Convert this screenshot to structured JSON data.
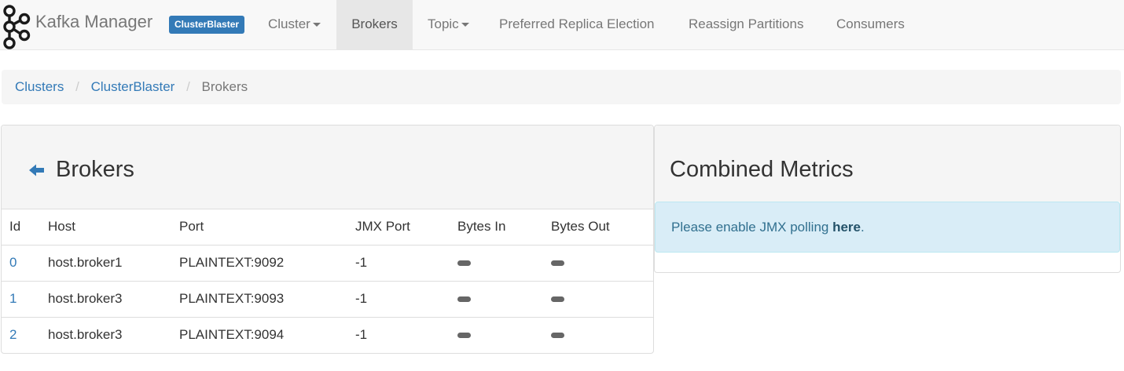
{
  "navbar": {
    "brand": "Kafka Manager",
    "cluster_badge": "ClusterBlaster",
    "items": [
      {
        "label": "Cluster"
      },
      {
        "label": "Brokers"
      },
      {
        "label": "Topic"
      },
      {
        "label": "Preferred Replica Election"
      },
      {
        "label": "Reassign Partitions"
      },
      {
        "label": "Consumers"
      }
    ],
    "active_item": "Brokers"
  },
  "breadcrumb": {
    "items": [
      "Clusters",
      "ClusterBlaster",
      "Brokers"
    ],
    "separator": "/"
  },
  "brokers_panel": {
    "title": "Brokers",
    "columns": [
      "Id",
      "Host",
      "Port",
      "JMX Port",
      "Bytes In",
      "Bytes Out"
    ],
    "rows": [
      {
        "id": "0",
        "host": "host.broker1",
        "port": "PLAINTEXT:9092",
        "jmx_port": "-1"
      },
      {
        "id": "1",
        "host": "host.broker3",
        "port": "PLAINTEXT:9093",
        "jmx_port": "-1"
      },
      {
        "id": "2",
        "host": "host.broker3",
        "port": "PLAINTEXT:9094",
        "jmx_port": "-1"
      }
    ]
  },
  "metrics_panel": {
    "title": "Combined Metrics",
    "alert_prefix": "Please enable JMX polling ",
    "alert_link": "here",
    "alert_suffix": "."
  },
  "colors": {
    "link": "#337ab7",
    "badge_bg": "#337ab7",
    "navbar_bg": "#f8f8f8",
    "active_nav_bg": "#e7e7e7",
    "alert_bg": "#d9edf7",
    "alert_text": "#31708f"
  },
  "icons": {
    "logo": "kafka-logo-icon",
    "back": "arrow-left-icon",
    "dropdown": "caret-down-icon",
    "loading": "loading-pill-icon"
  }
}
